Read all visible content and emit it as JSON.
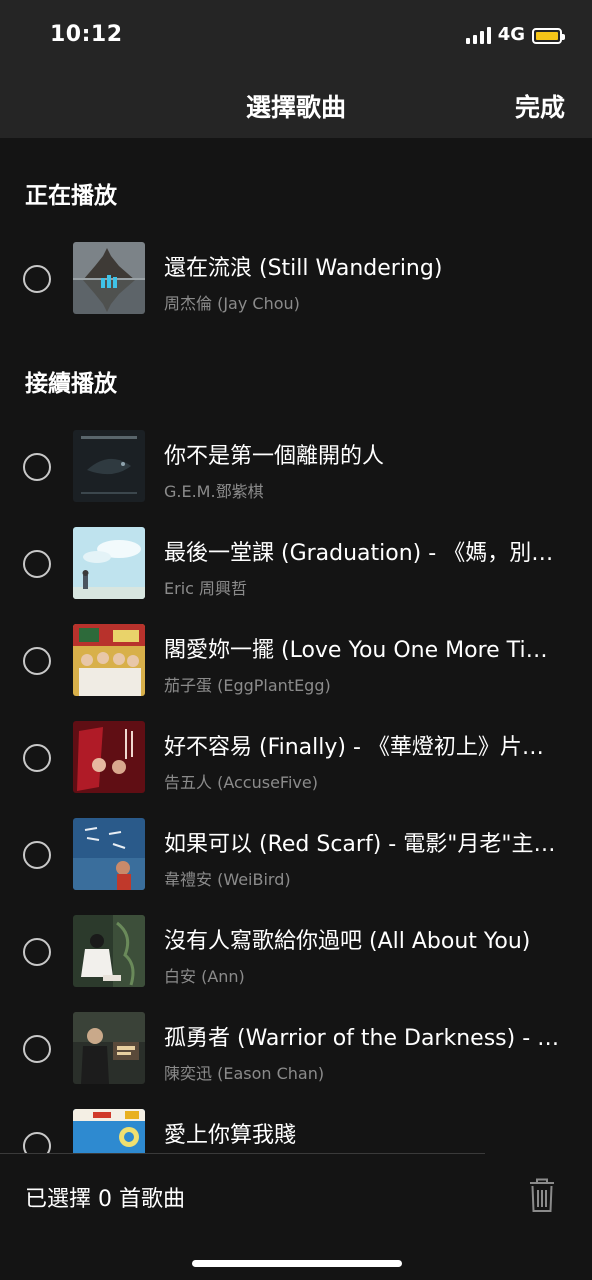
{
  "status_bar": {
    "time": "10:12",
    "network": "4G",
    "icons": [
      "signal-icon",
      "battery-icon"
    ],
    "battery_color": "#f5c518"
  },
  "nav": {
    "title": "選擇歌曲",
    "done_label": "完成"
  },
  "now_playing": {
    "header": "正在播放",
    "song": {
      "title": "還在流浪 (Still Wandering)",
      "artist": "周杰倫 (Jay Chou)",
      "art": "castle-reflection-art"
    }
  },
  "up_next": {
    "header": "接續播放",
    "songs": [
      {
        "title": "你不是第一個離開的人",
        "artist": "G.E.M.鄧紫棋",
        "art": "dark-fish-art"
      },
      {
        "title": "最後一堂課 (Graduation) - 《媽，別鬧了！》主題曲",
        "artist": "Eric 周興哲",
        "art": "sky-figure-art"
      },
      {
        "title": "閣愛妳一擺 (Love You One More Time)",
        "artist": "茄子蛋 (EggPlantEgg)",
        "art": "band-photo-art"
      },
      {
        "title": "好不容易 (Finally) - 《華燈初上》片尾曲",
        "artist": "告五人 (AccuseFive)",
        "art": "red-neon-art"
      },
      {
        "title": "如果可以 (Red Scarf) - 電影\"月老\"主題曲",
        "artist": "韋禮安 (WeiBird)",
        "art": "blue-calligraphy-art"
      },
      {
        "title": "沒有人寫歌給你過吧 (All About You)",
        "artist": "白安 (Ann)",
        "art": "garden-girl-art"
      },
      {
        "title": "孤勇者 (Warrior of the Darkness) - 《英雄聯盟：雙城之戰》動畫劇集中文主題曲",
        "artist": "陳奕迅 (Eason Chan)",
        "art": "dark-portrait-art"
      },
      {
        "title": "愛上你算我賤",
        "artist": "",
        "art": "blue-poster-art"
      }
    ]
  },
  "footer": {
    "selected_text": "已選擇 0 首歌曲",
    "trash_icon": "trash-icon"
  }
}
